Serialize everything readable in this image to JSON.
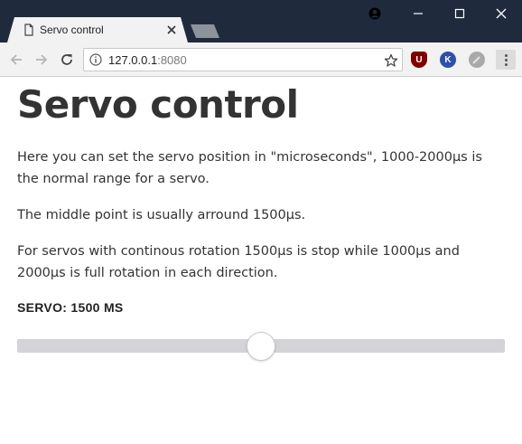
{
  "browser": {
    "tab_title": "Servo control",
    "url_host": "127.0.0.1",
    "url_port": ":8080",
    "extensions": [
      {
        "name": "ublock-icon",
        "letter": "U",
        "color": "#800000"
      },
      {
        "name": "k-extension-icon",
        "letter": "K",
        "color": "#2f4fa8"
      },
      {
        "name": "gray-extension-icon",
        "letter": "",
        "color": "#a9a9a9"
      }
    ],
    "frame_color": "#1f2b3d"
  },
  "page": {
    "title": "Servo control",
    "paragraphs": [
      "Here you can set the servo position in \"microseconds\", 1000-2000µs is the normal range for a servo.",
      "The middle point is usually arround 1500µs.",
      "For servos with continous rotation 1500µs is stop while 1000µs and 2000µs is full rotation in each direction."
    ],
    "servo_label": "SERVO: 1500 MS"
  },
  "slider": {
    "min": 1000,
    "max": 2000,
    "value": 1500
  }
}
